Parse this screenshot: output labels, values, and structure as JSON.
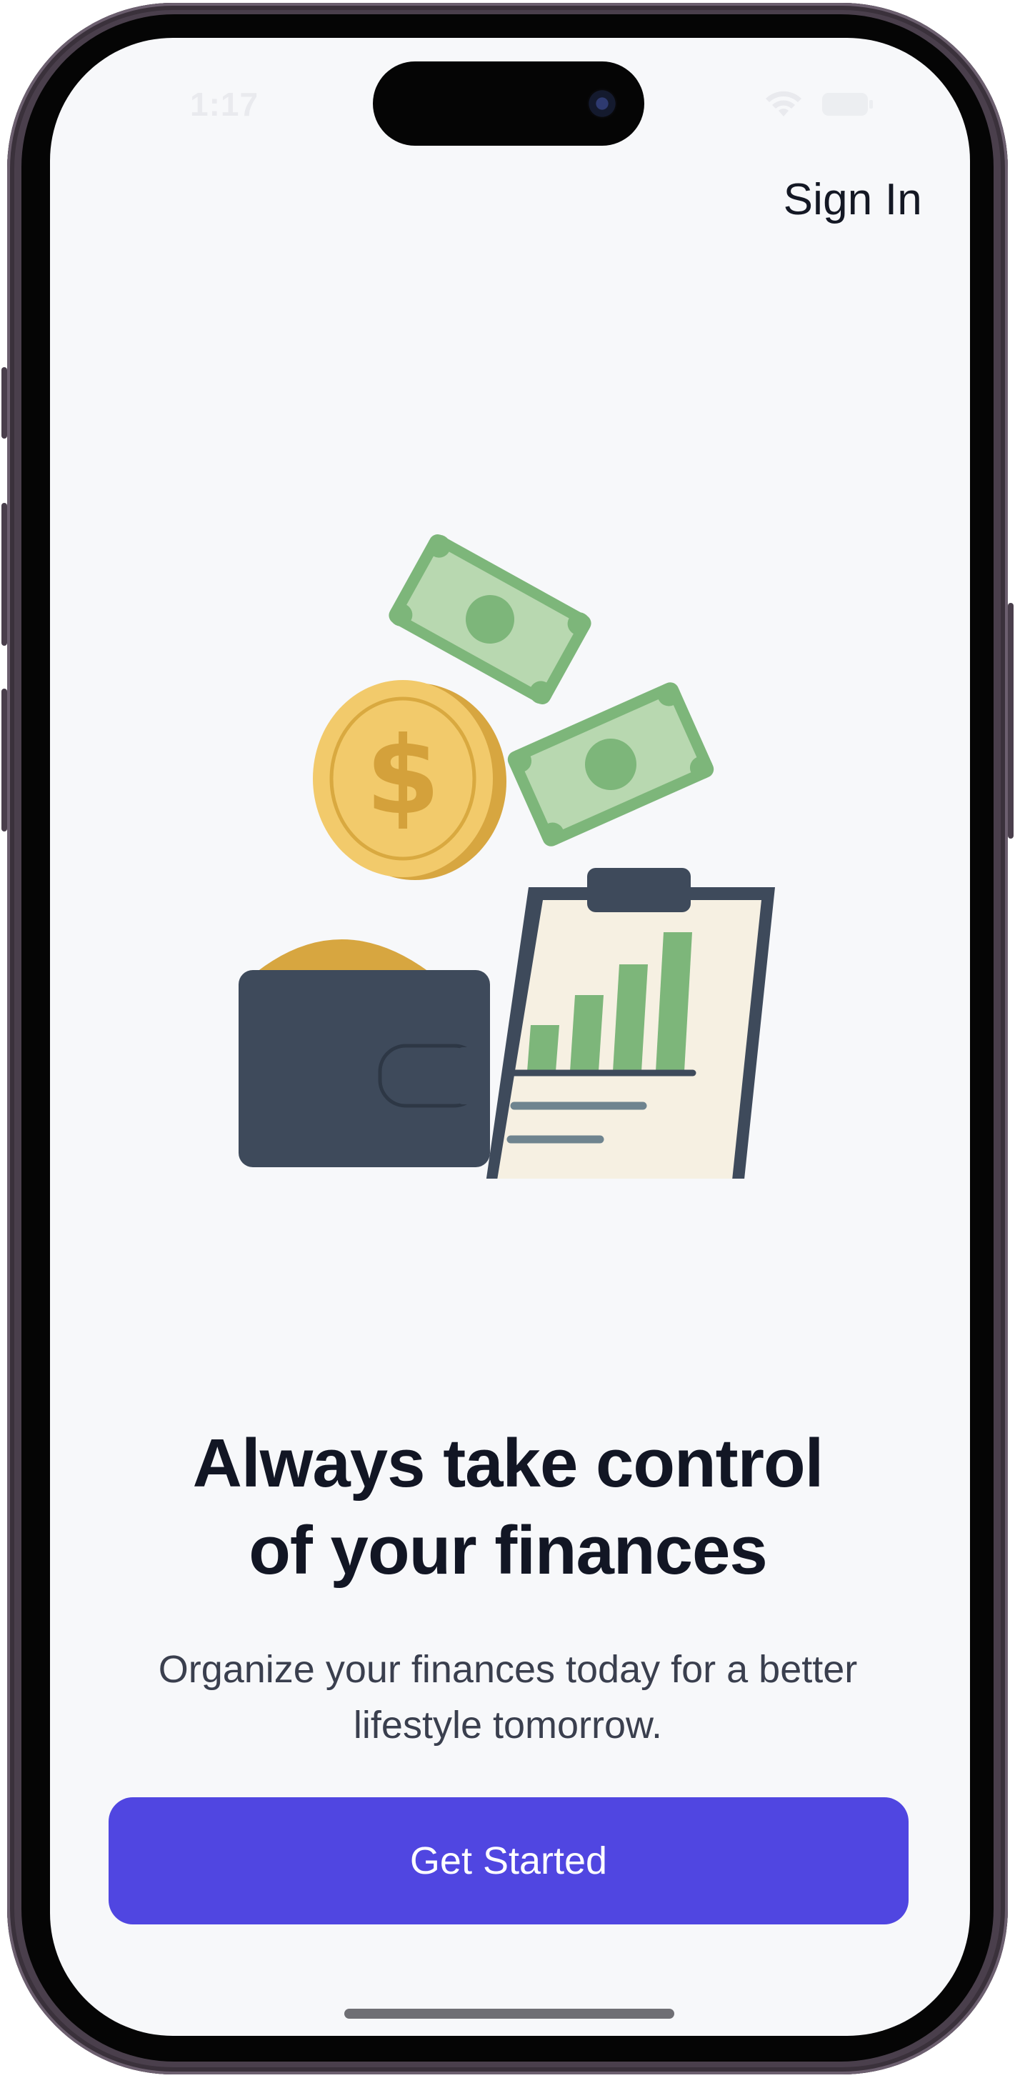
{
  "status_bar": {
    "time": "1:17",
    "wifi_icon": "wifi-icon",
    "battery_icon": "battery-icon"
  },
  "header": {
    "sign_in_label": "Sign In"
  },
  "hero": {
    "illustration_icons": [
      "money-bill-icon",
      "dollar-coin-icon",
      "wallet-icon",
      "clipboard-chart-icon"
    ]
  },
  "content": {
    "headline_line1": "Always take control",
    "headline_line2": "of your finances",
    "subtitle_line1": "Organize your finances today for a better",
    "subtitle_line2": "lifestyle tomorrow."
  },
  "actions": {
    "get_started_label": "Get Started"
  },
  "colors": {
    "primary": "#5046e1",
    "background": "#f7f8fa",
    "text_dark": "#121624",
    "text_muted": "#3a3f4e",
    "money_green": "#7db67a",
    "coin_gold": "#f2ca6b",
    "wallet_slate": "#3e4a5b"
  }
}
